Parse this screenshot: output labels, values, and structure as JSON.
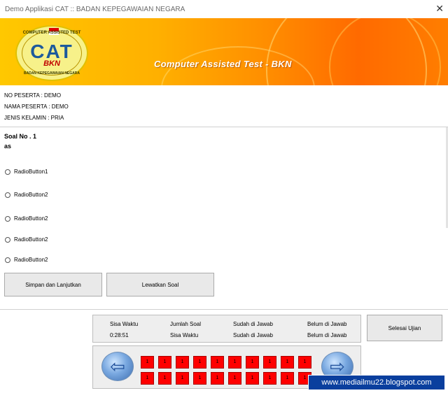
{
  "window": {
    "title": "Demo Applikasi CAT :: BADAN KEPEGAWAIAN NEGARA",
    "close_glyph": "✕"
  },
  "banner": {
    "logo": {
      "text_top": "COMPUTER ASSISTED TEST",
      "text_main": "CAT",
      "text_sub": "BKN",
      "text_bottom": "BADAN KEPEGAWAIAN NEGARA"
    },
    "subtitle": "Computer Assisted Test - BKN"
  },
  "participant": {
    "number": "NO PESERTA :  DEMO",
    "name": "NAMA PESERTA : DEMO",
    "gender": "JENIS KELAMIN : PRIA"
  },
  "question": {
    "number_label": "Soal No . 1",
    "text": "as"
  },
  "options": [
    "RadioButton1",
    "RadioButton2",
    "RadioButton2",
    "RadioButton2",
    "RadioButton2"
  ],
  "buttons": {
    "save_next": "Simpan dan Lanjutkan",
    "skip": "Lewatkan Soal",
    "finish": "Selesai Ujian"
  },
  "stats": {
    "headers": [
      "Sisa Waktu",
      "Jumlah Soal",
      "Sudah di Jawab",
      "Belum di Jawab"
    ],
    "values": [
      "0:28:51",
      "Sisa Waktu",
      "Sudah di Jawab",
      "Belum di Jawab"
    ]
  },
  "nav": {
    "prev_glyph": "⇦",
    "next_glyph": "⇨",
    "cells": [
      "1",
      "1",
      "1",
      "1",
      "1",
      "1",
      "1",
      "1",
      "1",
      "1",
      "1",
      "1",
      "1",
      "1",
      "1",
      "1",
      "1",
      "1",
      "1",
      "1"
    ]
  },
  "watermark": "www.mediailmu22.blogspot.com",
  "colors": {
    "banner_start": "#ffc800",
    "banner_end": "#ff6a00",
    "question_cell": "#ff0000",
    "watermark_bg": "#0a3f9e"
  }
}
